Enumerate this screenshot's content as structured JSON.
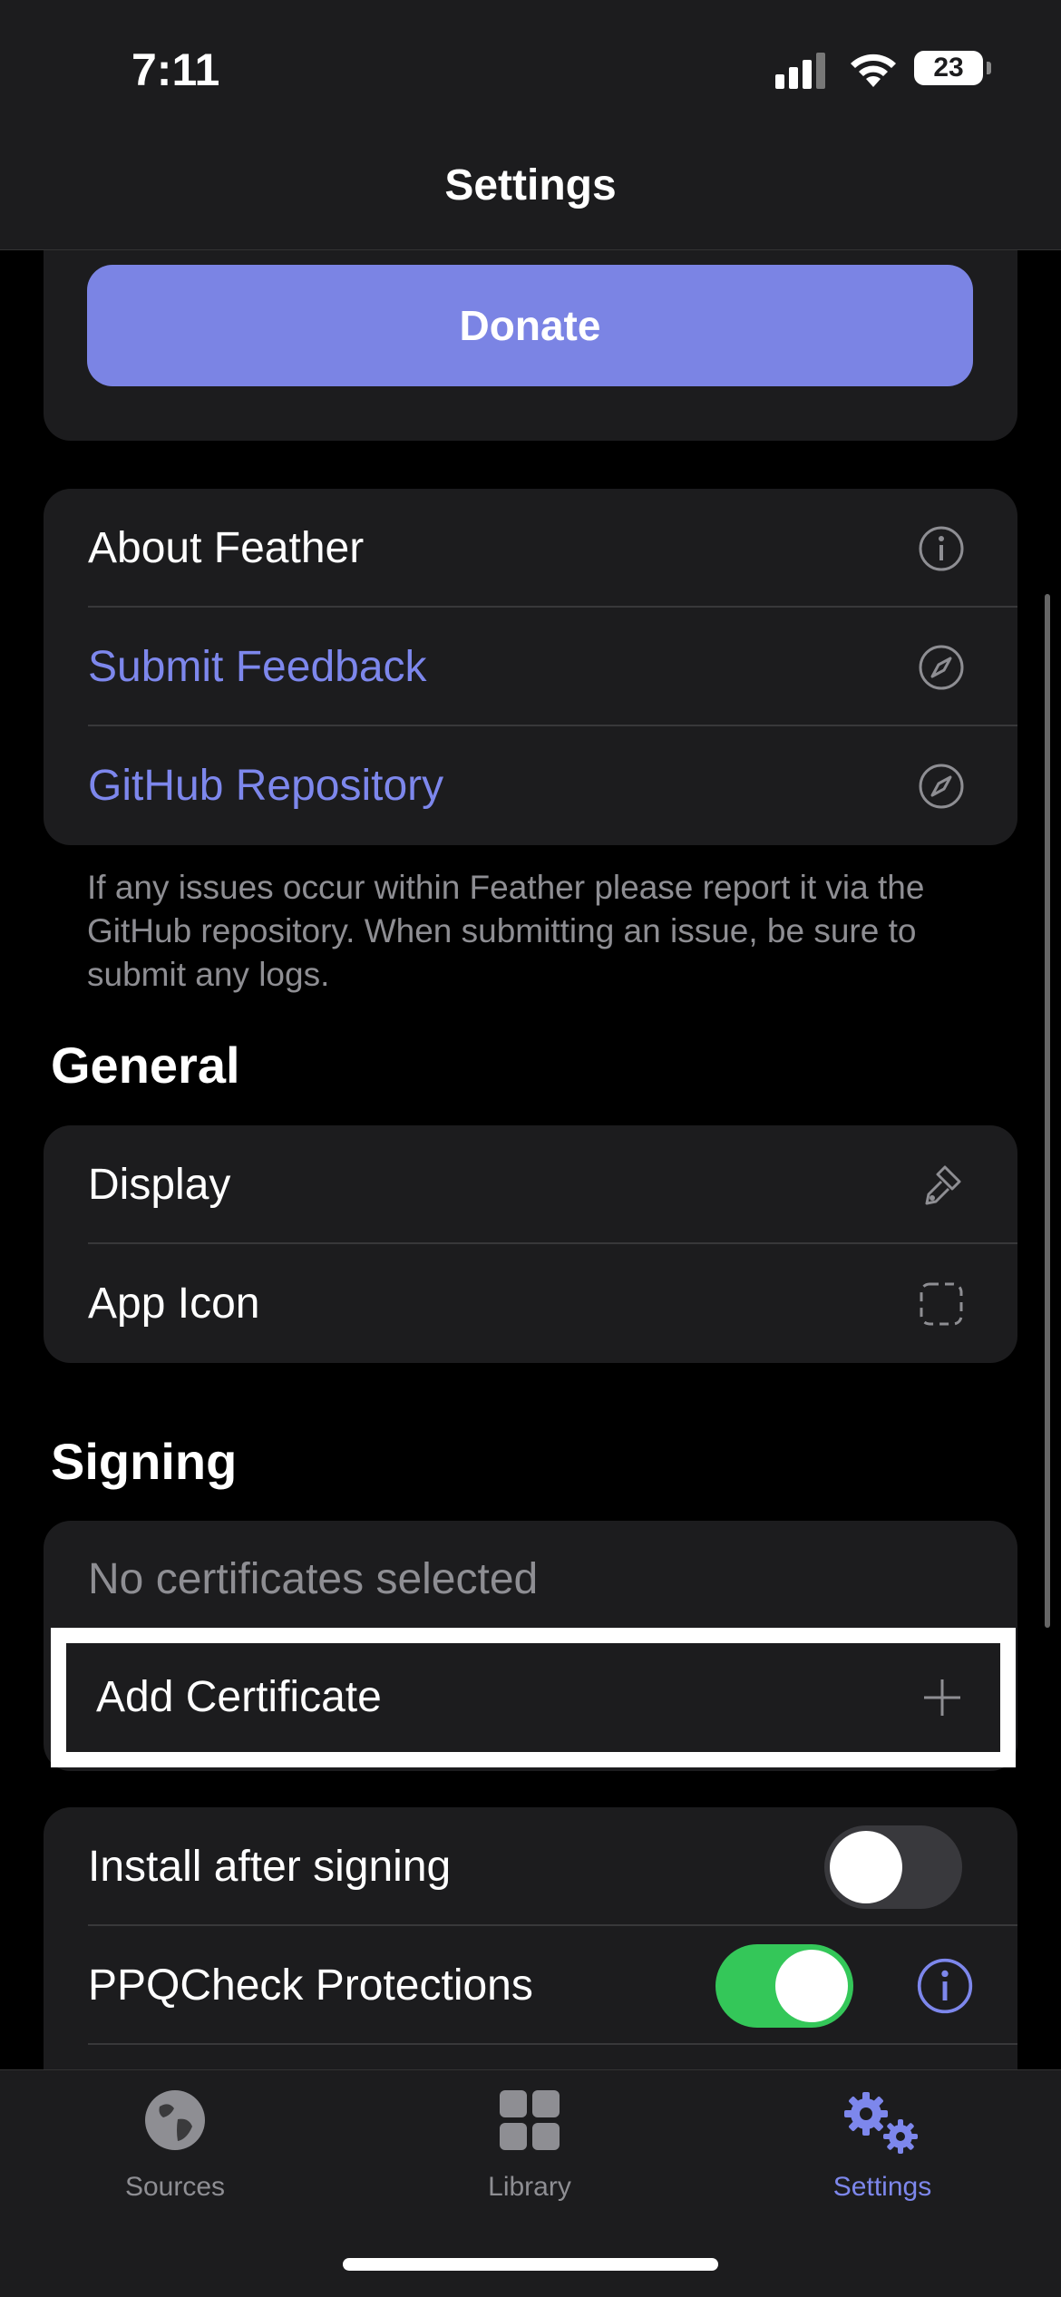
{
  "status_bar": {
    "time": "7:11",
    "battery": "23"
  },
  "nav": {
    "title": "Settings"
  },
  "donate": {
    "label": "Donate"
  },
  "about_section": {
    "items": [
      {
        "label": "About Feather",
        "icon": "info-icon"
      },
      {
        "label": "Submit Feedback",
        "icon": "compass-icon"
      },
      {
        "label": "GitHub Repository",
        "icon": "compass-icon"
      }
    ],
    "footnote": "If any issues occur within Feather please report it via the GitHub repository. When submitting an issue, be sure to submit any logs."
  },
  "general": {
    "title": "General",
    "items": [
      {
        "label": "Display",
        "icon": "paintbrush-icon"
      },
      {
        "label": "App Icon",
        "icon": "dashed-square-icon"
      }
    ]
  },
  "signing": {
    "title": "Signing",
    "no_certs": "No certificates selected",
    "add_certificate": "Add Certificate"
  },
  "options": {
    "install_after_signing": {
      "label": "Install after signing",
      "on": false
    },
    "ppqcheck": {
      "label": "PPQCheck Protections",
      "on": true
    }
  },
  "tabs": [
    {
      "label": "Sources",
      "icon": "globe-icon",
      "active": false
    },
    {
      "label": "Library",
      "icon": "grid-icon",
      "active": false
    },
    {
      "label": "Settings",
      "icon": "gears-icon",
      "active": true
    }
  ],
  "colors": {
    "accent": "#7d87ec",
    "toggle_on": "#34c759",
    "toggle_off": "#39393d",
    "background": "#000000",
    "card": "#1c1c1e"
  }
}
